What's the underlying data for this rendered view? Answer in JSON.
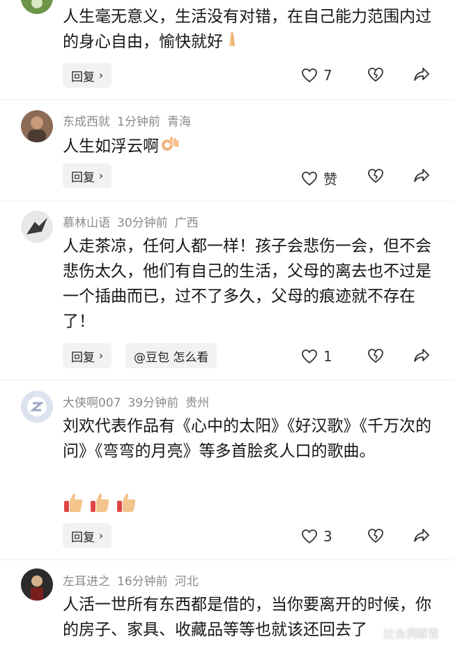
{
  "comments": [
    {
      "username": "",
      "time": "",
      "location": "",
      "text": "人生毫无意义，生活没有对错，在自己能力范围内过的身心自由，愉快就好",
      "reply_label": "回复",
      "like_count": "7"
    },
    {
      "username": "东成西就",
      "time": "1分钟前",
      "location": "青海",
      "text": "人生如浮云啊",
      "reply_label": "回复",
      "like_count": "赞"
    },
    {
      "username": "慕林山语",
      "time": "30分钟前",
      "location": "广西",
      "text": "人走茶凉，任何人都一样！孩子会悲伤一会，但不会悲伤太久，他们有自己的生活，父母的离去也不过是一个插曲而已，过不了多久，父母的痕迹就不存在了！",
      "reply_label": "回复",
      "extra_button": "@豆包 怎么看",
      "like_count": "1"
    },
    {
      "username": "大侠啊007",
      "time": "39分钟前",
      "location": "贵州",
      "text": "刘欢代表作品有《心中的太阳》《好汉歌》《千万次的问》《弯弯的月亮》等多首脍炙人口的歌曲。",
      "reply_label": "回复",
      "like_count": "3"
    },
    {
      "username": "左耳进之",
      "time": "16分钟前",
      "location": "河北",
      "text": "人活一世所有东西都是借的，当你要离开的时候，你的房子、家具、收藏品等等也就该还回去了"
    }
  ],
  "watermark": "社会洞察君",
  "icons": [
    "heart-icon",
    "broken-heart-icon",
    "share-icon",
    "praying-hands-emoji",
    "ok-hand-emoji",
    "thumbs-up-emoji"
  ]
}
